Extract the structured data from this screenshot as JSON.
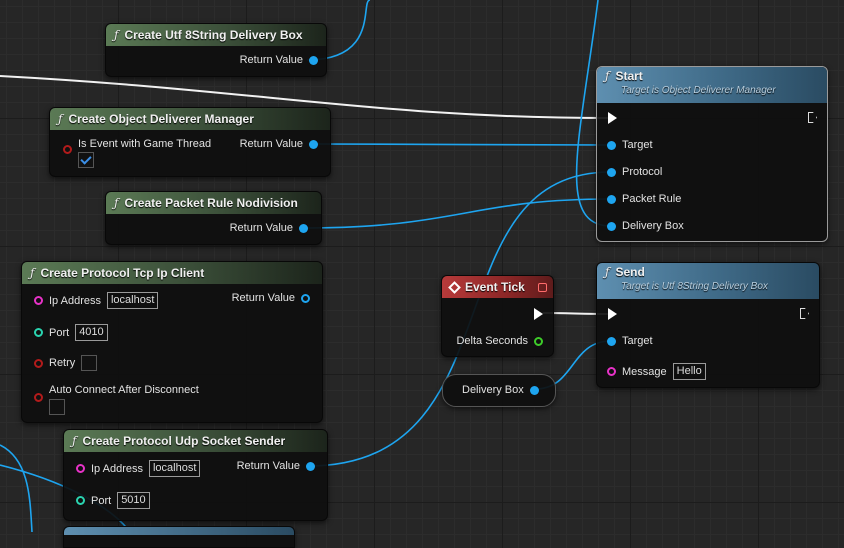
{
  "nodes": {
    "utf8_box": {
      "title": "Create Utf 8String Delivery Box",
      "return_label": "Return Value"
    },
    "obj_mgr": {
      "title": "Create Object Deliverer Manager",
      "game_thread_label": "Is Event with Game Thread",
      "return_label": "Return Value",
      "game_thread_checked": true
    },
    "packet_rule": {
      "title": "Create Packet Rule Nodivision",
      "return_label": "Return Value"
    },
    "tcp_client": {
      "title": "Create Protocol Tcp Ip Client",
      "ip_label": "Ip Address",
      "ip_value": "localhost",
      "port_label": "Port",
      "port_value": "4010",
      "retry_label": "Retry",
      "auto_label": "Auto Connect After Disconnect",
      "return_label": "Return Value"
    },
    "udp_sender": {
      "title": "Create Protocol Udp Socket Sender",
      "ip_label": "Ip Address",
      "ip_value": "localhost",
      "port_label": "Port",
      "port_value": "5010",
      "return_label": "Return Value"
    },
    "start": {
      "title": "Start",
      "subtitle": "Target is Object Deliverer Manager",
      "pins": [
        "Target",
        "Protocol",
        "Packet Rule",
        "Delivery Box"
      ]
    },
    "event_tick": {
      "title": "Event Tick",
      "delta_label": "Delta Seconds"
    },
    "delivery_var": {
      "label": "Delivery Box"
    },
    "send": {
      "title": "Send",
      "subtitle": "Target is Utf 8String Delivery Box",
      "target_label": "Target",
      "message_label": "Message",
      "message_value": "Hello"
    }
  },
  "colors": {
    "object_pin": "#1ea5f0",
    "string_pin": "#e832c8",
    "int_pin": "#2ad4b0",
    "bool_pin": "#b21b1b",
    "float_pin": "#3ecc2a",
    "exec_wire": "#ffffff"
  },
  "icons": {
    "function": "function-icon",
    "event": "event-diamond-icon"
  }
}
